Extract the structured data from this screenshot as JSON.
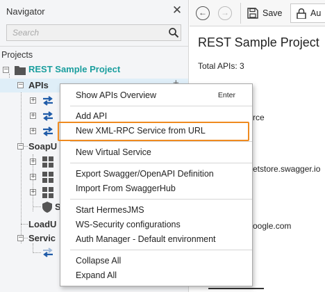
{
  "navigator": {
    "title": "Navigator",
    "close_glyph": "✕",
    "search_placeholder": "Search",
    "projects_label": "Projects",
    "project_name": "REST Sample Project",
    "tree": {
      "apis": "APIs",
      "soapui_partial": "SoapU",
      "soapui_child_partial": "S",
      "loadui_partial": "LoadU",
      "services_partial": "Servic"
    }
  },
  "toolbar": {
    "back_glyph": "←",
    "forward_glyph": "→",
    "save_label": "Save",
    "auth_label": "Au"
  },
  "main": {
    "title": "REST Sample Project",
    "total_apis": "Total APIs: 3",
    "partial_1": "rce",
    "partial_2": "etstore.swagger.io",
    "partial_3": "oogle.com"
  },
  "context_menu": {
    "items": [
      {
        "label": "Show APIs Overview",
        "shortcut": "Enter"
      },
      {
        "label": "Add API"
      },
      {
        "label": "New XML-RPC Service from URL"
      },
      {
        "label": "New Virtual Service"
      },
      {
        "label": "Export Swagger/OpenAPI Definition"
      },
      {
        "label": "Import From SwaggerHub"
      },
      {
        "label": "Start HermesJMS"
      },
      {
        "label": "WS-Security configurations"
      },
      {
        "label": "Auth Manager - Default environment"
      },
      {
        "label": "Collapse All"
      },
      {
        "label": "Expand All"
      }
    ]
  },
  "icons": {
    "search": "search-icon",
    "close": "close-icon",
    "folder": "folder-icon",
    "api": "api-arrows-icon",
    "grid": "grid-icon",
    "shield": "shield-icon",
    "save": "save-icon",
    "lock": "lock-icon"
  },
  "colors": {
    "project_name": "#1a9e9e",
    "api_icon": "#1f5ba8",
    "highlight": "#ef8a1f",
    "selected_row": "#dfeef8"
  }
}
